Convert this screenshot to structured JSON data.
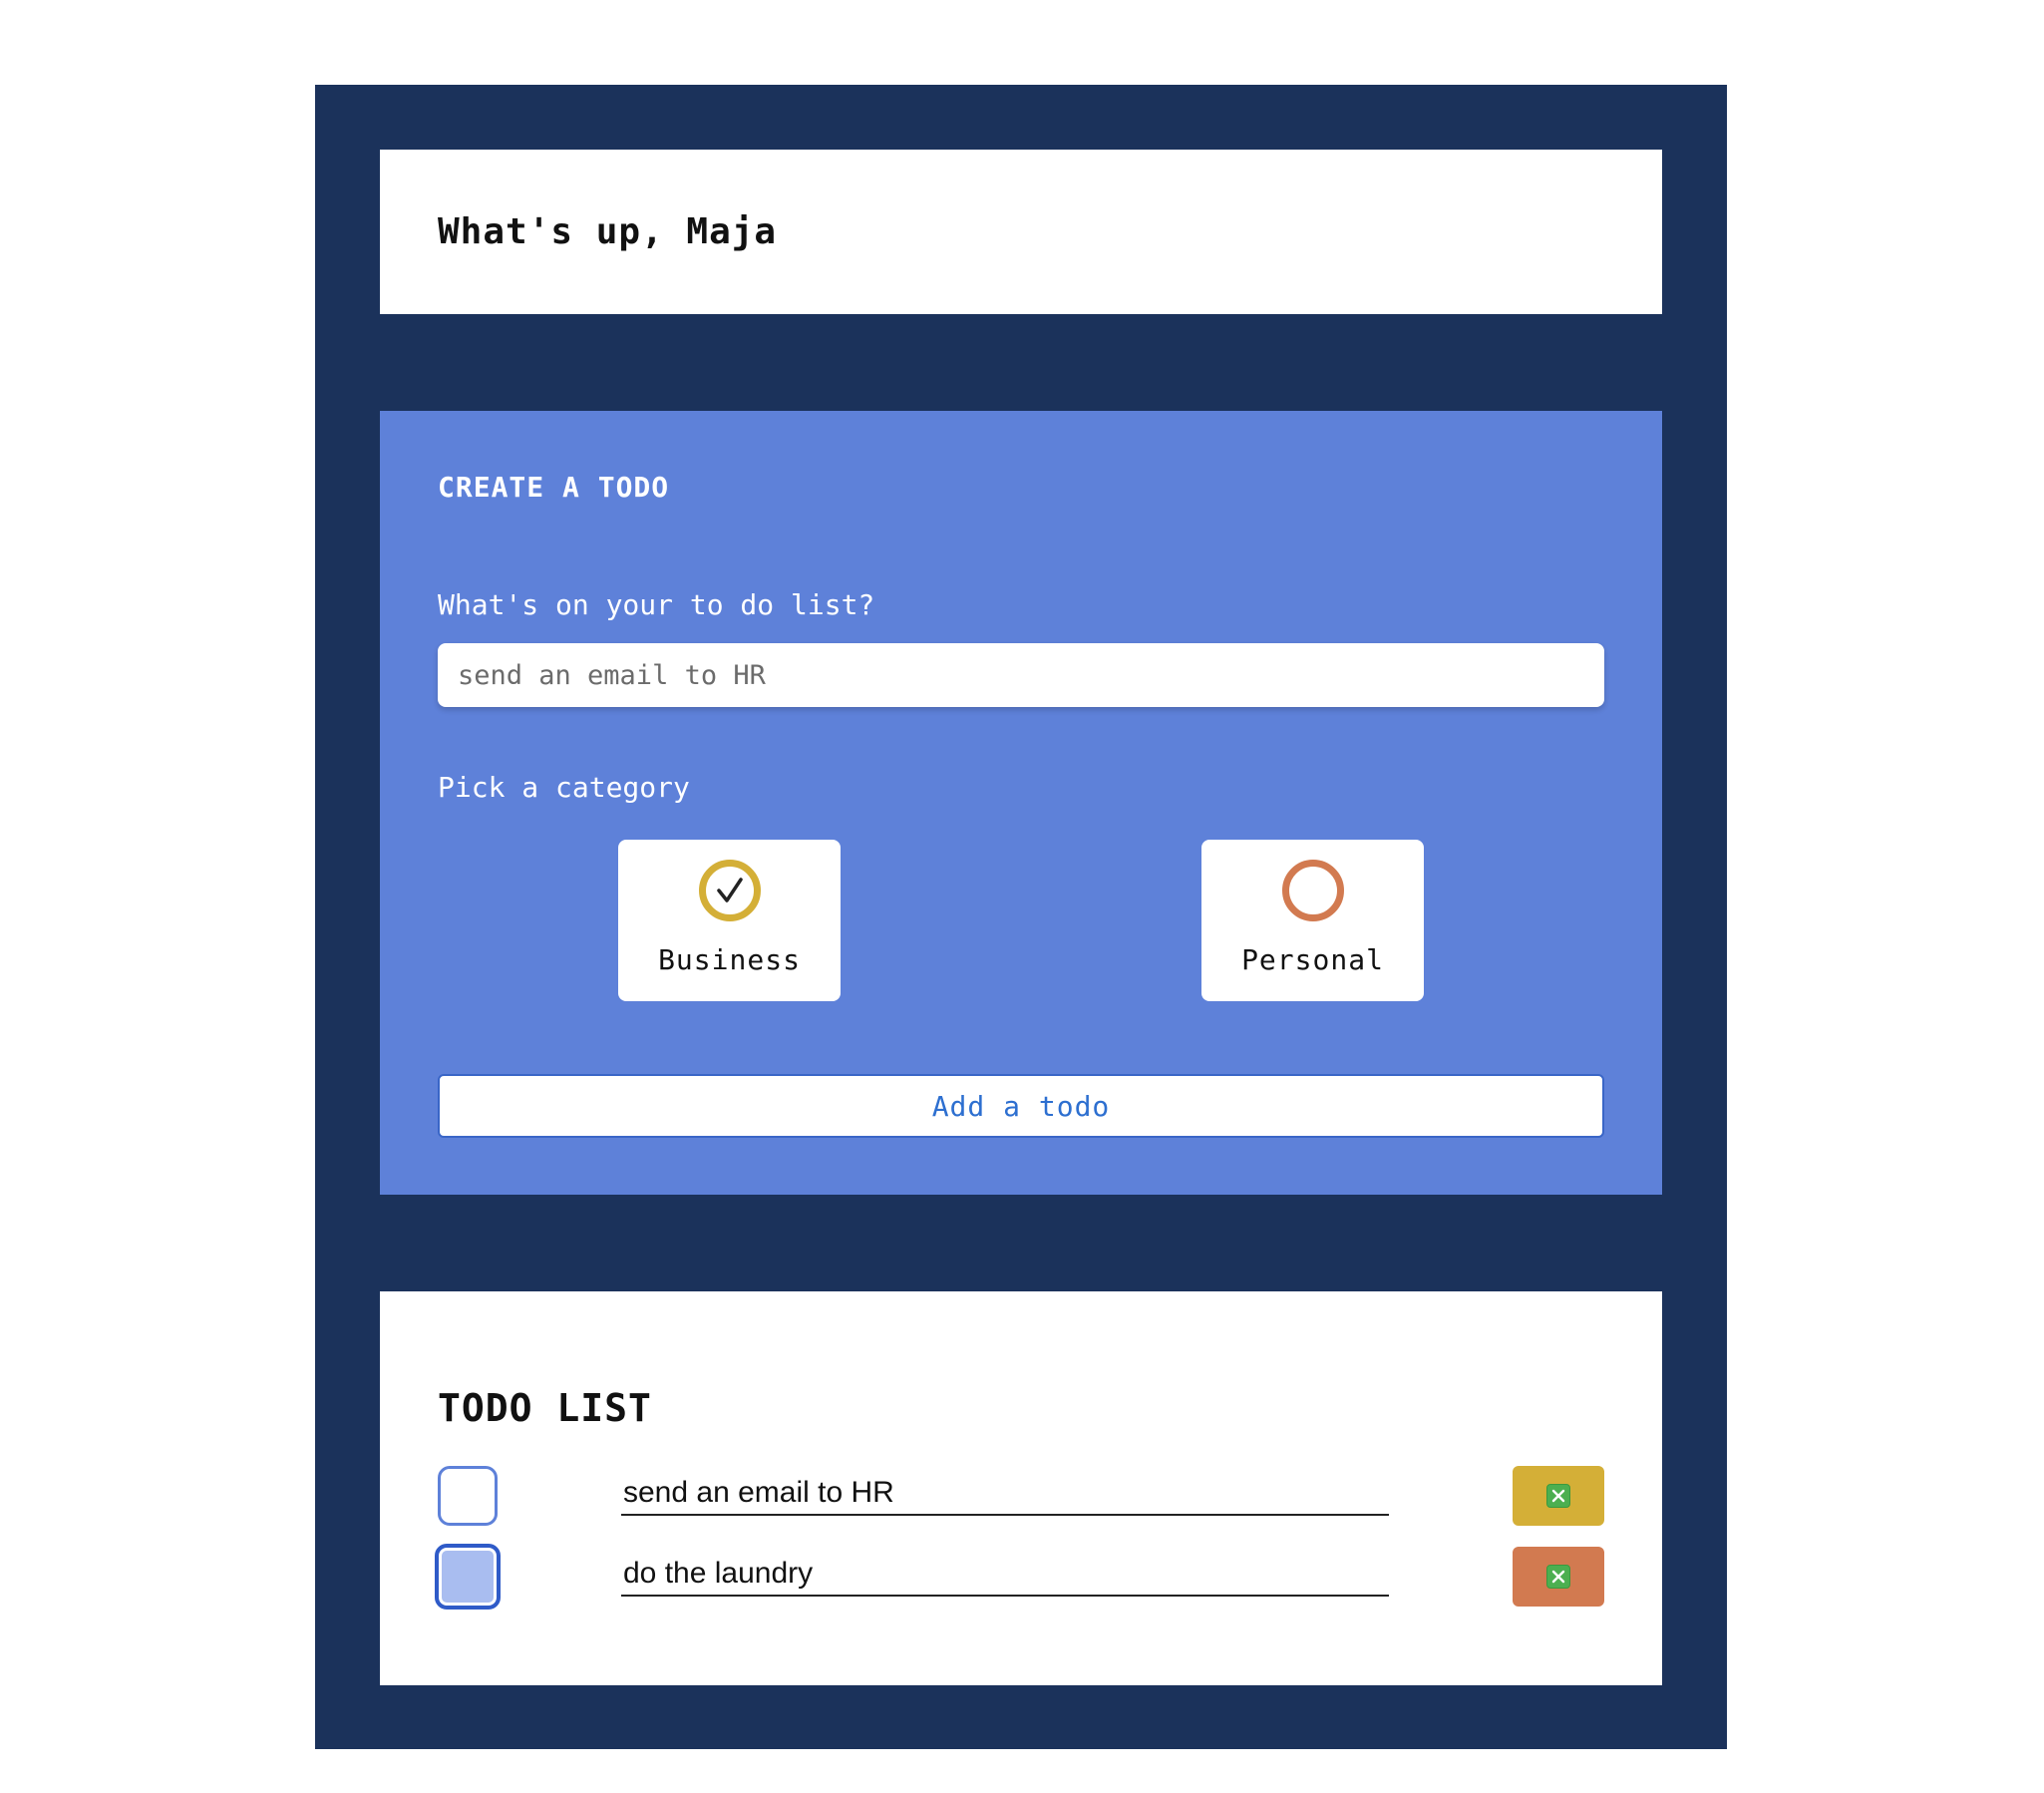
{
  "greeting": {
    "text": "What's up, Maja"
  },
  "create": {
    "title": "CREATE A TODO",
    "todo_label": "What's on your to do list?",
    "todo_placeholder": "send an email to HR",
    "category_label": "Pick a category",
    "categories": [
      {
        "label": "Business",
        "selected": true,
        "color": "#d4af37",
        "icon": "checkmark-icon"
      },
      {
        "label": "Personal",
        "selected": false,
        "color": "#d27a50",
        "icon": "circle-icon"
      }
    ],
    "add_button": "Add a todo"
  },
  "todo_list": {
    "title": "TODO LIST",
    "items": [
      {
        "text": "send an email to HR",
        "done": false,
        "category": "Business",
        "delete_color": "#d4af37",
        "delete_icon": "close-icon"
      },
      {
        "text": "do the laundry",
        "done": true,
        "category": "Personal",
        "delete_color": "#d27a50",
        "delete_icon": "close-icon"
      }
    ]
  },
  "colors": {
    "app_background": "#1b325b",
    "create_panel": "#5e81d9",
    "business": "#d4af37",
    "personal": "#d27a50",
    "accent": "#2d6fd0"
  }
}
